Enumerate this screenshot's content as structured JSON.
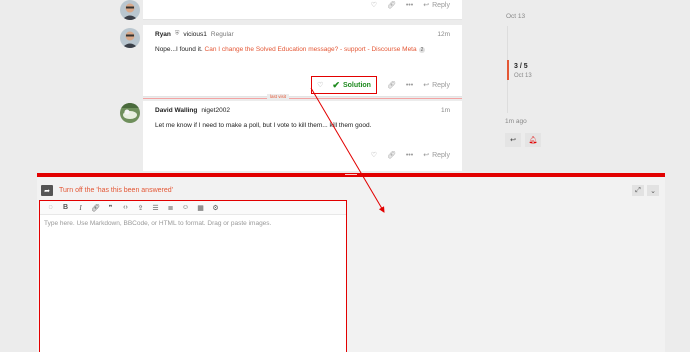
{
  "posts": [
    {
      "actions": {
        "reply_label": "Reply"
      }
    },
    {
      "username": "Ryan",
      "handle": "vicious1",
      "user_title": "Regular",
      "time": "12m",
      "text_prefix": "Nope...I found it. ",
      "link_text": "Can I change the Solved Education message? - support - Discourse Meta",
      "link_clicks": "2",
      "actions": {
        "solution_label": "Solution",
        "reply_label": "Reply"
      }
    },
    {
      "username": "David Walling",
      "handle": "niget2002",
      "time": "1m",
      "text": "Let me know if I need to make a poll, but I vote to kill them... kill them good.",
      "actions": {
        "reply_label": "Reply"
      }
    }
  ],
  "last_visit_label": "last visit",
  "timeline": {
    "top_date": "Oct 13",
    "position": "3 / 5",
    "current_date": "Oct 13",
    "last_activity": "1m ago"
  },
  "composer": {
    "reply_title": "Turn off the 'has this been answered'",
    "placeholder": "Type here. Use Markdown, BBCode, or HTML to format. Drag or paste images."
  },
  "colors": {
    "accent": "#e45735",
    "highlight": "#e20000",
    "solution": "#1e8a1e"
  }
}
